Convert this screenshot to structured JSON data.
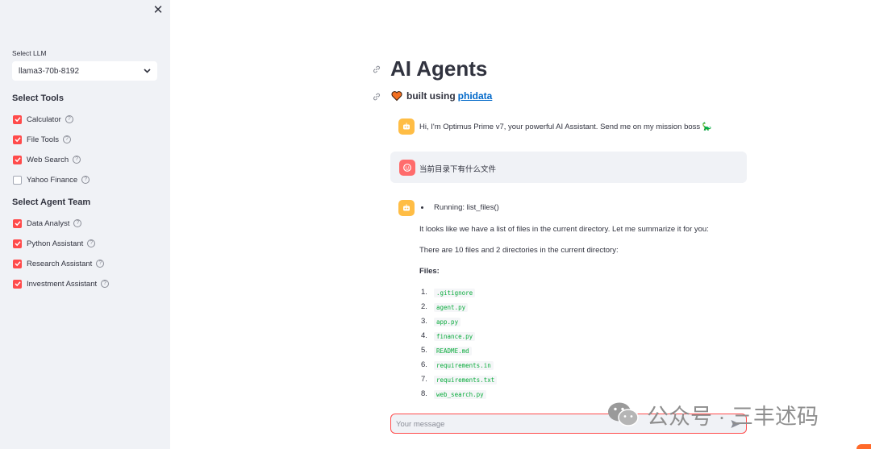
{
  "sidebar": {
    "close_symbol": "✕",
    "llm": {
      "label": "Select LLM",
      "selected": "llama3-70b-8192"
    },
    "tools": {
      "title": "Select Tools",
      "items": [
        {
          "label": "Calculator",
          "checked": true
        },
        {
          "label": "File Tools",
          "checked": true
        },
        {
          "label": "Web Search",
          "checked": true
        },
        {
          "label": "Yahoo Finance",
          "checked": false
        }
      ]
    },
    "team": {
      "title": "Select Agent Team",
      "items": [
        {
          "label": "Data Analyst",
          "checked": true
        },
        {
          "label": "Python Assistant",
          "checked": true
        },
        {
          "label": "Research Assistant",
          "checked": true
        },
        {
          "label": "Investment Assistant",
          "checked": true
        }
      ]
    }
  },
  "main": {
    "title": "AI Agents",
    "subtitle_prefix": "built using",
    "subtitle_link": "phidata",
    "messages": {
      "greeting": "Hi, I'm Optimus Prime v7, your powerful AI Assistant. Send me on my mission boss 🦕",
      "user": "当前目录下有什么文件",
      "running": "Running: list_files()",
      "para1": "It looks like we have a list of files in the current directory. Let me summarize it for you:",
      "para2": "There are 10 files and 2 directories in the current directory:",
      "files_heading": "Files:",
      "files": [
        {
          "num": "1.",
          "name": ".gitignore"
        },
        {
          "num": "2.",
          "name": "agent.py"
        },
        {
          "num": "3.",
          "name": "app.py"
        },
        {
          "num": "4.",
          "name": "finance.py"
        },
        {
          "num": "5.",
          "name": "README.md"
        },
        {
          "num": "6.",
          "name": "requirements.in"
        },
        {
          "num": "7.",
          "name": "requirements.txt"
        },
        {
          "num": "8.",
          "name": "web_search.py"
        }
      ]
    },
    "input": {
      "placeholder": "Your message"
    }
  },
  "watermark": {
    "text": "公众号 · 三丰述码"
  },
  "colors": {
    "accent": "#ff4b4b",
    "sidebar_bg": "#f0f2f6",
    "bot_avatar": "#ffbd45",
    "user_avatar": "#ff6c6c",
    "link": "#0068c9"
  }
}
